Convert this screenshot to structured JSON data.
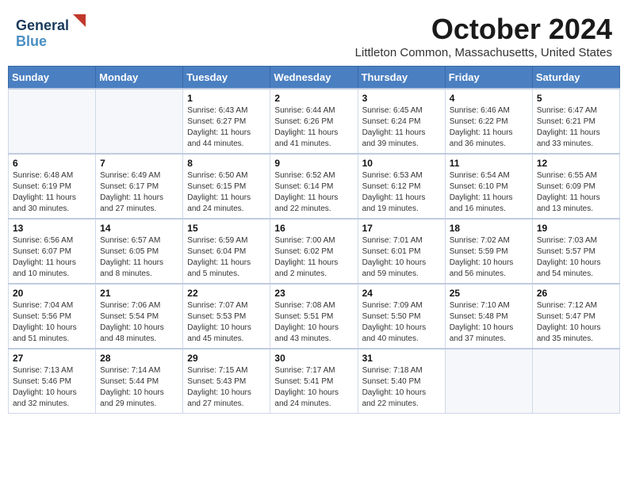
{
  "header": {
    "logo_line1": "General",
    "logo_line2": "Blue",
    "month": "October 2024",
    "location": "Littleton Common, Massachusetts, United States"
  },
  "weekdays": [
    "Sunday",
    "Monday",
    "Tuesday",
    "Wednesday",
    "Thursday",
    "Friday",
    "Saturday"
  ],
  "weeks": [
    [
      {
        "day": "",
        "detail": ""
      },
      {
        "day": "",
        "detail": ""
      },
      {
        "day": "1",
        "detail": "Sunrise: 6:43 AM\nSunset: 6:27 PM\nDaylight: 11 hours\nand 44 minutes."
      },
      {
        "day": "2",
        "detail": "Sunrise: 6:44 AM\nSunset: 6:26 PM\nDaylight: 11 hours\nand 41 minutes."
      },
      {
        "day": "3",
        "detail": "Sunrise: 6:45 AM\nSunset: 6:24 PM\nDaylight: 11 hours\nand 39 minutes."
      },
      {
        "day": "4",
        "detail": "Sunrise: 6:46 AM\nSunset: 6:22 PM\nDaylight: 11 hours\nand 36 minutes."
      },
      {
        "day": "5",
        "detail": "Sunrise: 6:47 AM\nSunset: 6:21 PM\nDaylight: 11 hours\nand 33 minutes."
      }
    ],
    [
      {
        "day": "6",
        "detail": "Sunrise: 6:48 AM\nSunset: 6:19 PM\nDaylight: 11 hours\nand 30 minutes."
      },
      {
        "day": "7",
        "detail": "Sunrise: 6:49 AM\nSunset: 6:17 PM\nDaylight: 11 hours\nand 27 minutes."
      },
      {
        "day": "8",
        "detail": "Sunrise: 6:50 AM\nSunset: 6:15 PM\nDaylight: 11 hours\nand 24 minutes."
      },
      {
        "day": "9",
        "detail": "Sunrise: 6:52 AM\nSunset: 6:14 PM\nDaylight: 11 hours\nand 22 minutes."
      },
      {
        "day": "10",
        "detail": "Sunrise: 6:53 AM\nSunset: 6:12 PM\nDaylight: 11 hours\nand 19 minutes."
      },
      {
        "day": "11",
        "detail": "Sunrise: 6:54 AM\nSunset: 6:10 PM\nDaylight: 11 hours\nand 16 minutes."
      },
      {
        "day": "12",
        "detail": "Sunrise: 6:55 AM\nSunset: 6:09 PM\nDaylight: 11 hours\nand 13 minutes."
      }
    ],
    [
      {
        "day": "13",
        "detail": "Sunrise: 6:56 AM\nSunset: 6:07 PM\nDaylight: 11 hours\nand 10 minutes."
      },
      {
        "day": "14",
        "detail": "Sunrise: 6:57 AM\nSunset: 6:05 PM\nDaylight: 11 hours\nand 8 minutes."
      },
      {
        "day": "15",
        "detail": "Sunrise: 6:59 AM\nSunset: 6:04 PM\nDaylight: 11 hours\nand 5 minutes."
      },
      {
        "day": "16",
        "detail": "Sunrise: 7:00 AM\nSunset: 6:02 PM\nDaylight: 11 hours\nand 2 minutes."
      },
      {
        "day": "17",
        "detail": "Sunrise: 7:01 AM\nSunset: 6:01 PM\nDaylight: 10 hours\nand 59 minutes."
      },
      {
        "day": "18",
        "detail": "Sunrise: 7:02 AM\nSunset: 5:59 PM\nDaylight: 10 hours\nand 56 minutes."
      },
      {
        "day": "19",
        "detail": "Sunrise: 7:03 AM\nSunset: 5:57 PM\nDaylight: 10 hours\nand 54 minutes."
      }
    ],
    [
      {
        "day": "20",
        "detail": "Sunrise: 7:04 AM\nSunset: 5:56 PM\nDaylight: 10 hours\nand 51 minutes."
      },
      {
        "day": "21",
        "detail": "Sunrise: 7:06 AM\nSunset: 5:54 PM\nDaylight: 10 hours\nand 48 minutes."
      },
      {
        "day": "22",
        "detail": "Sunrise: 7:07 AM\nSunset: 5:53 PM\nDaylight: 10 hours\nand 45 minutes."
      },
      {
        "day": "23",
        "detail": "Sunrise: 7:08 AM\nSunset: 5:51 PM\nDaylight: 10 hours\nand 43 minutes."
      },
      {
        "day": "24",
        "detail": "Sunrise: 7:09 AM\nSunset: 5:50 PM\nDaylight: 10 hours\nand 40 minutes."
      },
      {
        "day": "25",
        "detail": "Sunrise: 7:10 AM\nSunset: 5:48 PM\nDaylight: 10 hours\nand 37 minutes."
      },
      {
        "day": "26",
        "detail": "Sunrise: 7:12 AM\nSunset: 5:47 PM\nDaylight: 10 hours\nand 35 minutes."
      }
    ],
    [
      {
        "day": "27",
        "detail": "Sunrise: 7:13 AM\nSunset: 5:46 PM\nDaylight: 10 hours\nand 32 minutes."
      },
      {
        "day": "28",
        "detail": "Sunrise: 7:14 AM\nSunset: 5:44 PM\nDaylight: 10 hours\nand 29 minutes."
      },
      {
        "day": "29",
        "detail": "Sunrise: 7:15 AM\nSunset: 5:43 PM\nDaylight: 10 hours\nand 27 minutes."
      },
      {
        "day": "30",
        "detail": "Sunrise: 7:17 AM\nSunset: 5:41 PM\nDaylight: 10 hours\nand 24 minutes."
      },
      {
        "day": "31",
        "detail": "Sunrise: 7:18 AM\nSunset: 5:40 PM\nDaylight: 10 hours\nand 22 minutes."
      },
      {
        "day": "",
        "detail": ""
      },
      {
        "day": "",
        "detail": ""
      }
    ]
  ]
}
